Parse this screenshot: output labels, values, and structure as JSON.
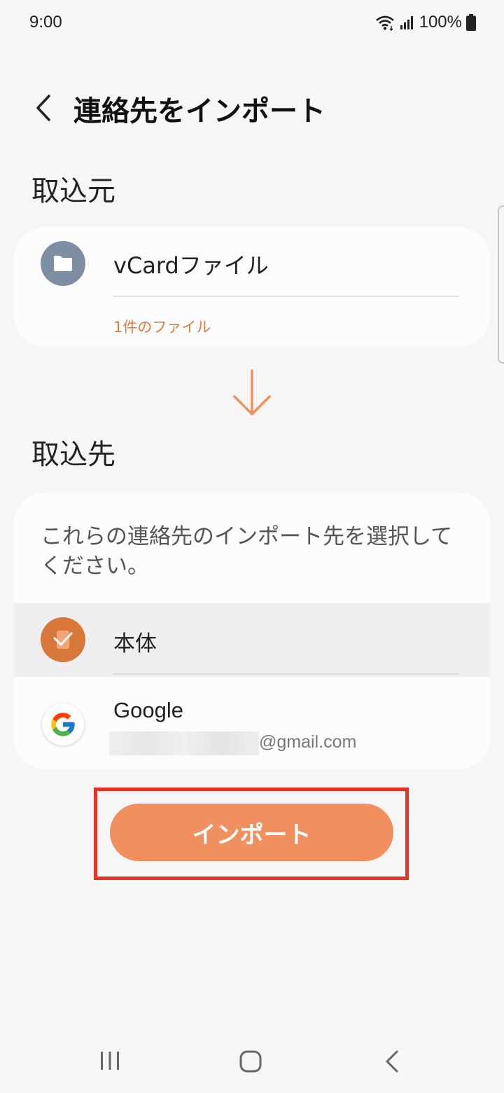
{
  "status_bar": {
    "time": "9:00",
    "battery": "100%"
  },
  "header": {
    "title": "連絡先をインポート"
  },
  "source": {
    "section_title": "取込元",
    "item_label": "vCardファイル",
    "file_count": "1件のファイル"
  },
  "destination": {
    "section_title": "取込先",
    "description": "これらの連絡先のインポート先を選択してください。",
    "options": [
      {
        "label": "本体",
        "selected": true
      },
      {
        "label": "Google",
        "email_domain": "@gmail.com",
        "selected": false
      }
    ]
  },
  "actions": {
    "import_label": "インポート"
  },
  "colors": {
    "accent": "#f0905f",
    "accent_dark": "#d8773a",
    "file_count": "#e07b3e",
    "highlight": "#e63323",
    "folder_icon_bg": "#7e8ea3"
  }
}
